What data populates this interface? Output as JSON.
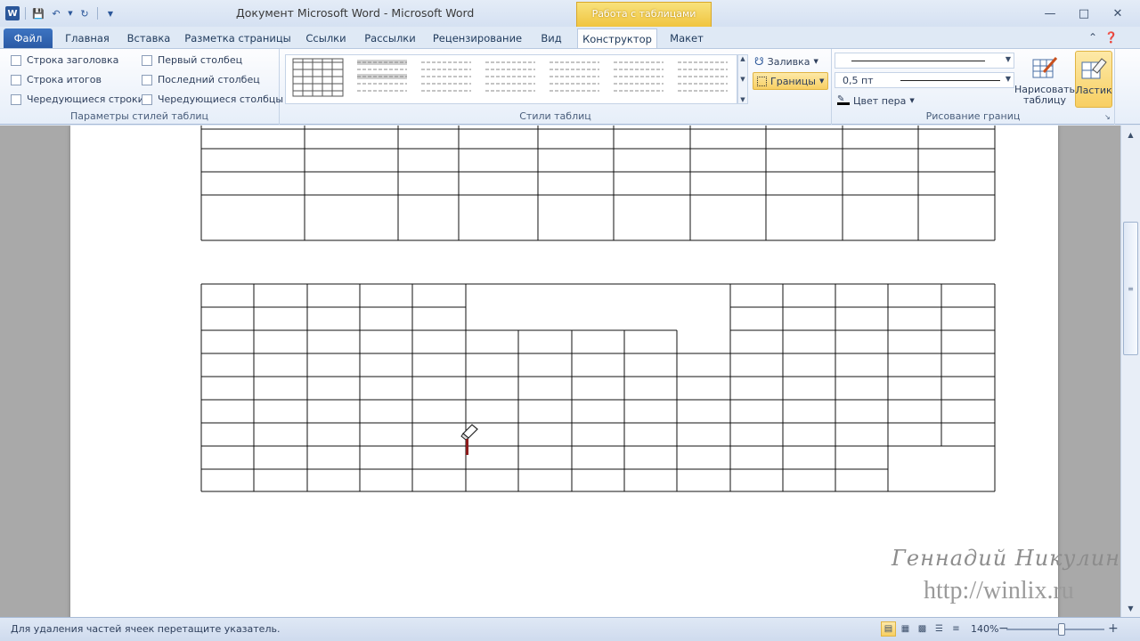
{
  "window": {
    "title": "Документ Microsoft Word  -  Microsoft Word",
    "context_group": "Работа с таблицами"
  },
  "tabs": [
    {
      "label": "Файл"
    },
    {
      "label": "Главная"
    },
    {
      "label": "Вставка"
    },
    {
      "label": "Разметка страницы"
    },
    {
      "label": "Ссылки"
    },
    {
      "label": "Рассылки"
    },
    {
      "label": "Рецензирование"
    },
    {
      "label": "Вид"
    },
    {
      "label": "Конструктор"
    },
    {
      "label": "Макет"
    }
  ],
  "ribbon": {
    "style_options": {
      "label": "Параметры стилей таблиц",
      "header_row": "Строка заголовка",
      "total_row": "Строка итогов",
      "banded_rows": "Чередующиеся строки",
      "first_column": "Первый столбец",
      "last_column": "Последний столбец",
      "banded_columns": "Чередующиеся столбцы"
    },
    "table_styles": {
      "label": "Стили таблиц",
      "shading": "Заливка",
      "borders": "Границы"
    },
    "draw_borders": {
      "label": "Рисование границ",
      "weight": "0,5 пт",
      "pen_color": "Цвет пера",
      "draw_table_line1": "Нарисовать",
      "draw_table_line2": "таблицу",
      "eraser": "Ластик"
    }
  },
  "document": {
    "watermark_name": "Геннадий Никулин",
    "watermark_url": "http://winlix.ru"
  },
  "status": {
    "message": "Для удаления частей ячеек перетащите указатель.",
    "zoom": "140%",
    "zoom_fraction": 0.56
  },
  "colors": {
    "accent": "#2b579a",
    "context_tab": "#f0c43f",
    "selected_button": "#f8cf62"
  }
}
